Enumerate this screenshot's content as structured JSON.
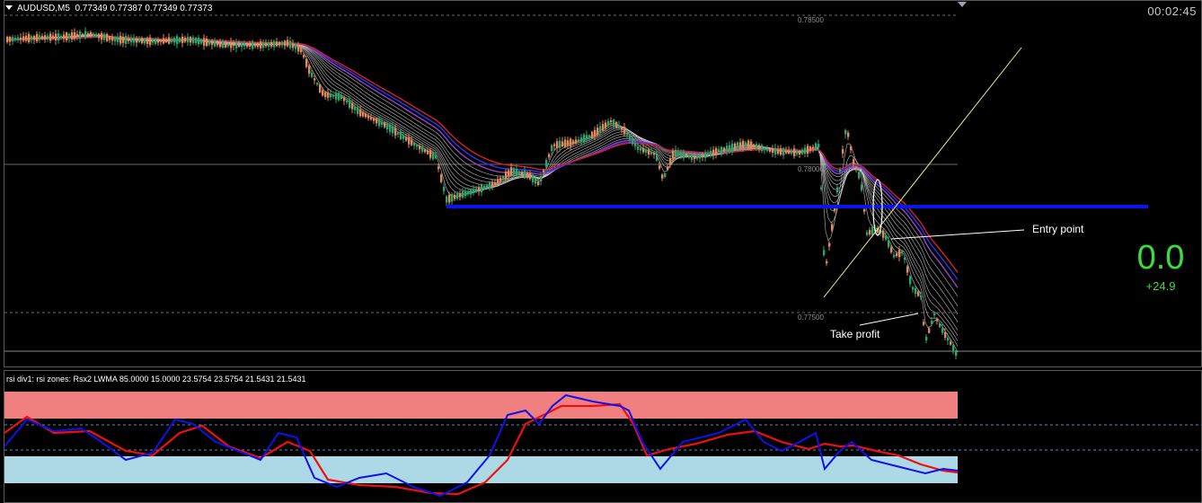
{
  "header": {
    "symbol": "AUDUSD,M5",
    "quotes": "0.77349 0.77387 0.77349 0.77373",
    "timer": "00:02:45"
  },
  "price_levels": {
    "level_top": "0.78500",
    "level_mid": "0.78000",
    "level_low": "0.77500"
  },
  "panel": {
    "profit_main": "0.0",
    "profit_sub": "+24.9"
  },
  "annotations": {
    "entry": "Entry point",
    "take_profit": "Take profit"
  },
  "rsi": {
    "header": "rsi div1: rsi zones: Rsx2 LWMA 85.0000 15.0000 23.5754 23.5754 21.5431 21.5431"
  },
  "colors": {
    "background": "#000000",
    "bull_candle": "#2ea56e",
    "bear_candle": "#e08a5a",
    "support_line": "#0a14f0",
    "trend_line": "#f2ee8c",
    "profit_text": "#3bdc3b",
    "rsi_upper_zone": "#f08080",
    "rsi_lower_zone": "#add8e6",
    "rsi_fast": "#1010ee",
    "rsi_slow": "#ee1010"
  }
}
